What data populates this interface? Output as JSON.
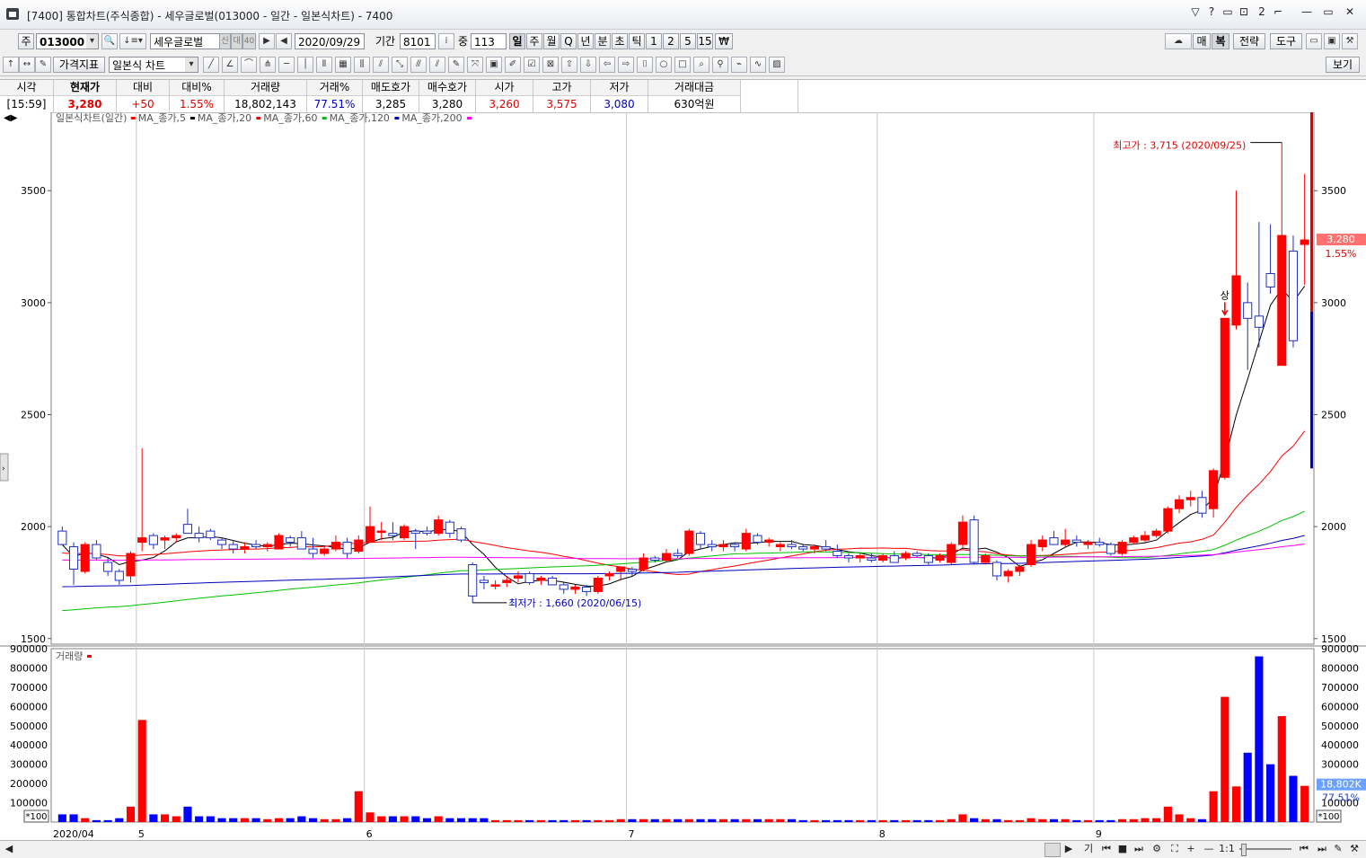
{
  "window": {
    "title": "[7400] 통합차트(주식종합) - 세우글로벌(013000 - 일간 - 일본식차트) - 7400",
    "controls": [
      "▽",
      "?",
      "▭",
      "⊡",
      "2",
      "⌐",
      "—",
      "▭",
      "✕"
    ]
  },
  "toolbar": {
    "market_label": "주",
    "code": "013000",
    "stock_name": "세우글로벌",
    "badges": [
      "신",
      "대",
      "40"
    ],
    "date": "2020/09/29",
    "period_label": "기간",
    "period_value": "8101",
    "count_label": "중",
    "count_value": "113",
    "intervals": [
      "일",
      "주",
      "월",
      "Q",
      "년",
      "분",
      "초",
      "틱",
      "1",
      "2",
      "5",
      "15",
      "₩"
    ],
    "right_buttons": [
      "매",
      "복",
      "전략",
      "도구"
    ],
    "indicator_label": "가격지표",
    "chart_type": "일본식 차트",
    "view_label": "보기"
  },
  "quote": {
    "headers": [
      "시각",
      "현재가",
      "대비",
      "대비%",
      "거래량",
      "거래%",
      "매도호가",
      "매수호가",
      "시가",
      "고가",
      "저가",
      "거래대금"
    ],
    "values": [
      "[15:59]",
      "3,280",
      "+50",
      "1.55%",
      "18,802,143",
      "77.51%",
      "3,285",
      "3,280",
      "3,260",
      "3,575",
      "3,080",
      "630억원"
    ]
  },
  "legend": {
    "price_title": "일본식차트(일간)",
    "ma": [
      {
        "label": "MA_종가,5",
        "color": "#ff0000"
      },
      {
        "label": "MA_종가,20",
        "color": "#000000"
      },
      {
        "label": "MA_종가,60",
        "color": "#ff0000"
      },
      {
        "label": "MA_종가,120",
        "color": "#00c000"
      },
      {
        "label": "MA_종가,200",
        "color": "#0000c0"
      },
      {
        "label": "",
        "color": "#ff00ff"
      }
    ],
    "volume_title": "거래량"
  },
  "annotations": {
    "high": "최고가 : 3,715 (2020/09/25)",
    "low": "최저가 : 1,660 (2020/06/15)",
    "up_mark": "상",
    "price_tag": "3,280",
    "change_tag": "1.55%",
    "vol_tag": "18,802K",
    "vol_pct_tag": "77.51%",
    "vol_unit": "*100"
  },
  "x_axis": {
    "start_label": "2020/04",
    "month_labels": [
      "5",
      "6",
      "7",
      "8",
      "9"
    ]
  },
  "scroll_controls": [
    "기",
    "⏮",
    "■",
    "⏭",
    "⚙",
    "⛶",
    "+",
    "—",
    "1:1"
  ],
  "colors": {
    "up": "#ff0000",
    "down": "#0000ff",
    "grid": "#c8c8c8"
  },
  "chart_data": {
    "type": "candlestick",
    "price_axis": {
      "ticks": [
        1500,
        2000,
        2500,
        3000,
        3500
      ],
      "ylim": [
        1475,
        3850
      ]
    },
    "volume_axis": {
      "ticks": [
        100000,
        200000,
        300000,
        400000,
        500000,
        600000,
        700000,
        800000,
        900000
      ],
      "ylim": [
        0,
        900000
      ],
      "unit": "*100"
    },
    "candles": [
      {
        "o": 1980,
        "h": 2000,
        "l": 1920,
        "c": 1920,
        "v": 40000
      },
      {
        "o": 1910,
        "h": 1930,
        "l": 1740,
        "c": 1810,
        "v": 40000
      },
      {
        "o": 1800,
        "h": 1930,
        "l": 1790,
        "c": 1920,
        "v": 20000
      },
      {
        "o": 1920,
        "h": 1940,
        "l": 1850,
        "c": 1860,
        "v": 10000
      },
      {
        "o": 1840,
        "h": 1860,
        "l": 1780,
        "c": 1800,
        "v": 10000
      },
      {
        "o": 1800,
        "h": 1810,
        "l": 1740,
        "c": 1760,
        "v": 20000
      },
      {
        "o": 1780,
        "h": 1890,
        "l": 1750,
        "c": 1880,
        "v": 80000
      },
      {
        "o": 1930,
        "h": 2350,
        "l": 1890,
        "c": 1950,
        "v": 530000
      },
      {
        "o": 1960,
        "h": 1970,
        "l": 1900,
        "c": 1920,
        "v": 40000
      },
      {
        "o": 1940,
        "h": 1960,
        "l": 1900,
        "c": 1950,
        "v": 40000
      },
      {
        "o": 1950,
        "h": 1970,
        "l": 1930,
        "c": 1960,
        "v": 30000
      },
      {
        "o": 2010,
        "h": 2080,
        "l": 1970,
        "c": 1970,
        "v": 80000
      },
      {
        "o": 1970,
        "h": 2000,
        "l": 1930,
        "c": 1950,
        "v": 30000
      },
      {
        "o": 1980,
        "h": 1990,
        "l": 1940,
        "c": 1950,
        "v": 30000
      },
      {
        "o": 1940,
        "h": 1950,
        "l": 1900,
        "c": 1920,
        "v": 20000
      },
      {
        "o": 1920,
        "h": 1940,
        "l": 1880,
        "c": 1900,
        "v": 20000
      },
      {
        "o": 1900,
        "h": 1930,
        "l": 1880,
        "c": 1910,
        "v": 20000
      },
      {
        "o": 1920,
        "h": 1940,
        "l": 1900,
        "c": 1910,
        "v": 20000
      },
      {
        "o": 1910,
        "h": 1930,
        "l": 1890,
        "c": 1920,
        "v": 15000
      },
      {
        "o": 1900,
        "h": 1970,
        "l": 1900,
        "c": 1960,
        "v": 20000
      },
      {
        "o": 1950,
        "h": 1960,
        "l": 1910,
        "c": 1930,
        "v": 20000
      },
      {
        "o": 1950,
        "h": 1980,
        "l": 1900,
        "c": 1900,
        "v": 30000
      },
      {
        "o": 1900,
        "h": 1950,
        "l": 1860,
        "c": 1880,
        "v": 20000
      },
      {
        "o": 1880,
        "h": 1910,
        "l": 1870,
        "c": 1900,
        "v": 15000
      },
      {
        "o": 1900,
        "h": 1960,
        "l": 1890,
        "c": 1930,
        "v": 15000
      },
      {
        "o": 1930,
        "h": 1950,
        "l": 1860,
        "c": 1880,
        "v": 20000
      },
      {
        "o": 1890,
        "h": 1960,
        "l": 1880,
        "c": 1940,
        "v": 160000
      },
      {
        "o": 1930,
        "h": 2090,
        "l": 1930,
        "c": 2000,
        "v": 50000
      },
      {
        "o": 1980,
        "h": 2020,
        "l": 1940,
        "c": 1980,
        "v": 30000
      },
      {
        "o": 1970,
        "h": 2020,
        "l": 1940,
        "c": 1960,
        "v": 30000
      },
      {
        "o": 1950,
        "h": 2010,
        "l": 1940,
        "c": 2000,
        "v": 30000
      },
      {
        "o": 1980,
        "h": 1990,
        "l": 1900,
        "c": 1970,
        "v": 30000
      },
      {
        "o": 1980,
        "h": 2000,
        "l": 1960,
        "c": 1970,
        "v": 20000
      },
      {
        "o": 1970,
        "h": 2050,
        "l": 1960,
        "c": 2030,
        "v": 30000
      },
      {
        "o": 2020,
        "h": 2030,
        "l": 1950,
        "c": 1970,
        "v": 20000
      },
      {
        "o": 1990,
        "h": 2000,
        "l": 1930,
        "c": 1940,
        "v": 20000
      },
      {
        "o": 1830,
        "h": 1840,
        "l": 1660,
        "c": 1690,
        "v": 20000
      },
      {
        "o": 1760,
        "h": 1780,
        "l": 1720,
        "c": 1750,
        "v": 20000
      },
      {
        "o": 1740,
        "h": 1760,
        "l": 1720,
        "c": 1740,
        "v": 10000
      },
      {
        "o": 1750,
        "h": 1780,
        "l": 1730,
        "c": 1760,
        "v": 10000
      },
      {
        "o": 1770,
        "h": 1800,
        "l": 1750,
        "c": 1780,
        "v": 10000
      },
      {
        "o": 1790,
        "h": 1800,
        "l": 1740,
        "c": 1750,
        "v": 10000
      },
      {
        "o": 1760,
        "h": 1780,
        "l": 1740,
        "c": 1770,
        "v": 10000
      },
      {
        "o": 1770,
        "h": 1780,
        "l": 1740,
        "c": 1740,
        "v": 10000
      },
      {
        "o": 1740,
        "h": 1750,
        "l": 1700,
        "c": 1720,
        "v": 10000
      },
      {
        "o": 1720,
        "h": 1740,
        "l": 1700,
        "c": 1730,
        "v": 10000
      },
      {
        "o": 1730,
        "h": 1740,
        "l": 1690,
        "c": 1710,
        "v": 10000
      },
      {
        "o": 1710,
        "h": 1780,
        "l": 1700,
        "c": 1770,
        "v": 10000
      },
      {
        "o": 1780,
        "h": 1800,
        "l": 1760,
        "c": 1790,
        "v": 10000
      },
      {
        "o": 1800,
        "h": 1820,
        "l": 1760,
        "c": 1820,
        "v": 15000
      },
      {
        "o": 1810,
        "h": 1820,
        "l": 1780,
        "c": 1800,
        "v": 15000
      },
      {
        "o": 1810,
        "h": 1880,
        "l": 1800,
        "c": 1860,
        "v": 15000
      },
      {
        "o": 1860,
        "h": 1870,
        "l": 1840,
        "c": 1850,
        "v": 15000
      },
      {
        "o": 1850,
        "h": 1900,
        "l": 1840,
        "c": 1880,
        "v": 15000
      },
      {
        "o": 1880,
        "h": 1900,
        "l": 1860,
        "c": 1870,
        "v": 15000
      },
      {
        "o": 1880,
        "h": 1990,
        "l": 1870,
        "c": 1980,
        "v": 15000
      },
      {
        "o": 1970,
        "h": 1980,
        "l": 1900,
        "c": 1920,
        "v": 15000
      },
      {
        "o": 1920,
        "h": 1940,
        "l": 1890,
        "c": 1910,
        "v": 15000
      },
      {
        "o": 1910,
        "h": 1940,
        "l": 1890,
        "c": 1920,
        "v": 15000
      },
      {
        "o": 1920,
        "h": 1930,
        "l": 1890,
        "c": 1910,
        "v": 15000
      },
      {
        "o": 1900,
        "h": 1990,
        "l": 1890,
        "c": 1970,
        "v": 15000
      },
      {
        "o": 1960,
        "h": 1970,
        "l": 1920,
        "c": 1930,
        "v": 15000
      },
      {
        "o": 1930,
        "h": 1950,
        "l": 1910,
        "c": 1940,
        "v": 15000
      },
      {
        "o": 1910,
        "h": 1930,
        "l": 1890,
        "c": 1920,
        "v": 15000
      },
      {
        "o": 1920,
        "h": 1940,
        "l": 1900,
        "c": 1910,
        "v": 15000
      },
      {
        "o": 1910,
        "h": 1920,
        "l": 1890,
        "c": 1900,
        "v": 10000
      },
      {
        "o": 1900,
        "h": 1920,
        "l": 1880,
        "c": 1910,
        "v": 10000
      },
      {
        "o": 1910,
        "h": 1940,
        "l": 1890,
        "c": 1900,
        "v": 10000
      },
      {
        "o": 1890,
        "h": 1920,
        "l": 1860,
        "c": 1870,
        "v": 10000
      },
      {
        "o": 1870,
        "h": 1880,
        "l": 1840,
        "c": 1860,
        "v": 10000
      },
      {
        "o": 1860,
        "h": 1880,
        "l": 1840,
        "c": 1870,
        "v": 10000
      },
      {
        "o": 1860,
        "h": 1880,
        "l": 1840,
        "c": 1850,
        "v": 10000
      },
      {
        "o": 1850,
        "h": 1880,
        "l": 1840,
        "c": 1870,
        "v": 10000
      },
      {
        "o": 1870,
        "h": 1890,
        "l": 1840,
        "c": 1840,
        "v": 10000
      },
      {
        "o": 1860,
        "h": 1890,
        "l": 1850,
        "c": 1880,
        "v": 10000
      },
      {
        "o": 1880,
        "h": 1890,
        "l": 1860,
        "c": 1870,
        "v": 10000
      },
      {
        "o": 1870,
        "h": 1880,
        "l": 1830,
        "c": 1840,
        "v": 10000
      },
      {
        "o": 1850,
        "h": 1880,
        "l": 1840,
        "c": 1870,
        "v": 10000
      },
      {
        "o": 1840,
        "h": 1930,
        "l": 1830,
        "c": 1920,
        "v": 15000
      },
      {
        "o": 1920,
        "h": 2050,
        "l": 1900,
        "c": 2020,
        "v": 40000
      },
      {
        "o": 2030,
        "h": 2050,
        "l": 1830,
        "c": 1840,
        "v": 20000
      },
      {
        "o": 1840,
        "h": 1880,
        "l": 1830,
        "c": 1870,
        "v": 15000
      },
      {
        "o": 1840,
        "h": 1850,
        "l": 1760,
        "c": 1780,
        "v": 15000
      },
      {
        "o": 1780,
        "h": 1810,
        "l": 1750,
        "c": 1800,
        "v": 10000
      },
      {
        "o": 1800,
        "h": 1830,
        "l": 1780,
        "c": 1820,
        "v": 10000
      },
      {
        "o": 1830,
        "h": 1940,
        "l": 1820,
        "c": 1920,
        "v": 20000
      },
      {
        "o": 1910,
        "h": 1960,
        "l": 1890,
        "c": 1940,
        "v": 15000
      },
      {
        "o": 1950,
        "h": 1980,
        "l": 1920,
        "c": 1920,
        "v": 15000
      },
      {
        "o": 1920,
        "h": 1990,
        "l": 1910,
        "c": 1940,
        "v": 15000
      },
      {
        "o": 1940,
        "h": 1960,
        "l": 1910,
        "c": 1930,
        "v": 10000
      },
      {
        "o": 1920,
        "h": 1940,
        "l": 1900,
        "c": 1930,
        "v": 10000
      },
      {
        "o": 1930,
        "h": 1950,
        "l": 1910,
        "c": 1920,
        "v": 10000
      },
      {
        "o": 1920,
        "h": 1930,
        "l": 1870,
        "c": 1880,
        "v": 10000
      },
      {
        "o": 1880,
        "h": 1940,
        "l": 1870,
        "c": 1930,
        "v": 15000
      },
      {
        "o": 1930,
        "h": 1960,
        "l": 1920,
        "c": 1950,
        "v": 15000
      },
      {
        "o": 1940,
        "h": 1980,
        "l": 1930,
        "c": 1960,
        "v": 20000
      },
      {
        "o": 1960,
        "h": 1990,
        "l": 1950,
        "c": 1980,
        "v": 20000
      },
      {
        "o": 1980,
        "h": 2090,
        "l": 1970,
        "c": 2080,
        "v": 80000
      },
      {
        "o": 2080,
        "h": 2140,
        "l": 2060,
        "c": 2120,
        "v": 40000
      },
      {
        "o": 2120,
        "h": 2160,
        "l": 2090,
        "c": 2130,
        "v": 20000
      },
      {
        "o": 2130,
        "h": 2160,
        "l": 2040,
        "c": 2060,
        "v": 15000
      },
      {
        "o": 2080,
        "h": 2260,
        "l": 2040,
        "c": 2250,
        "v": 160000
      },
      {
        "o": 2220,
        "h": 2930,
        "l": 2210,
        "c": 2930,
        "v": 650000
      },
      {
        "o": 2900,
        "h": 3500,
        "l": 2880,
        "c": 3120,
        "v": 185000
      },
      {
        "o": 3000,
        "h": 3090,
        "l": 2700,
        "c": 2930,
        "v": 360000
      },
      {
        "o": 2940,
        "h": 3360,
        "l": 2800,
        "c": 2890,
        "v": 860000
      },
      {
        "o": 3130,
        "h": 3350,
        "l": 3040,
        "c": 3070,
        "v": 300000
      },
      {
        "o": 2720,
        "h": 3715,
        "l": 2720,
        "c": 3300,
        "v": 550000
      },
      {
        "o": 3230,
        "h": 3300,
        "l": 2800,
        "c": 2830,
        "v": 240000
      },
      {
        "o": 3260,
        "h": 3575,
        "l": 3080,
        "c": 3280,
        "v": 188000
      }
    ]
  }
}
